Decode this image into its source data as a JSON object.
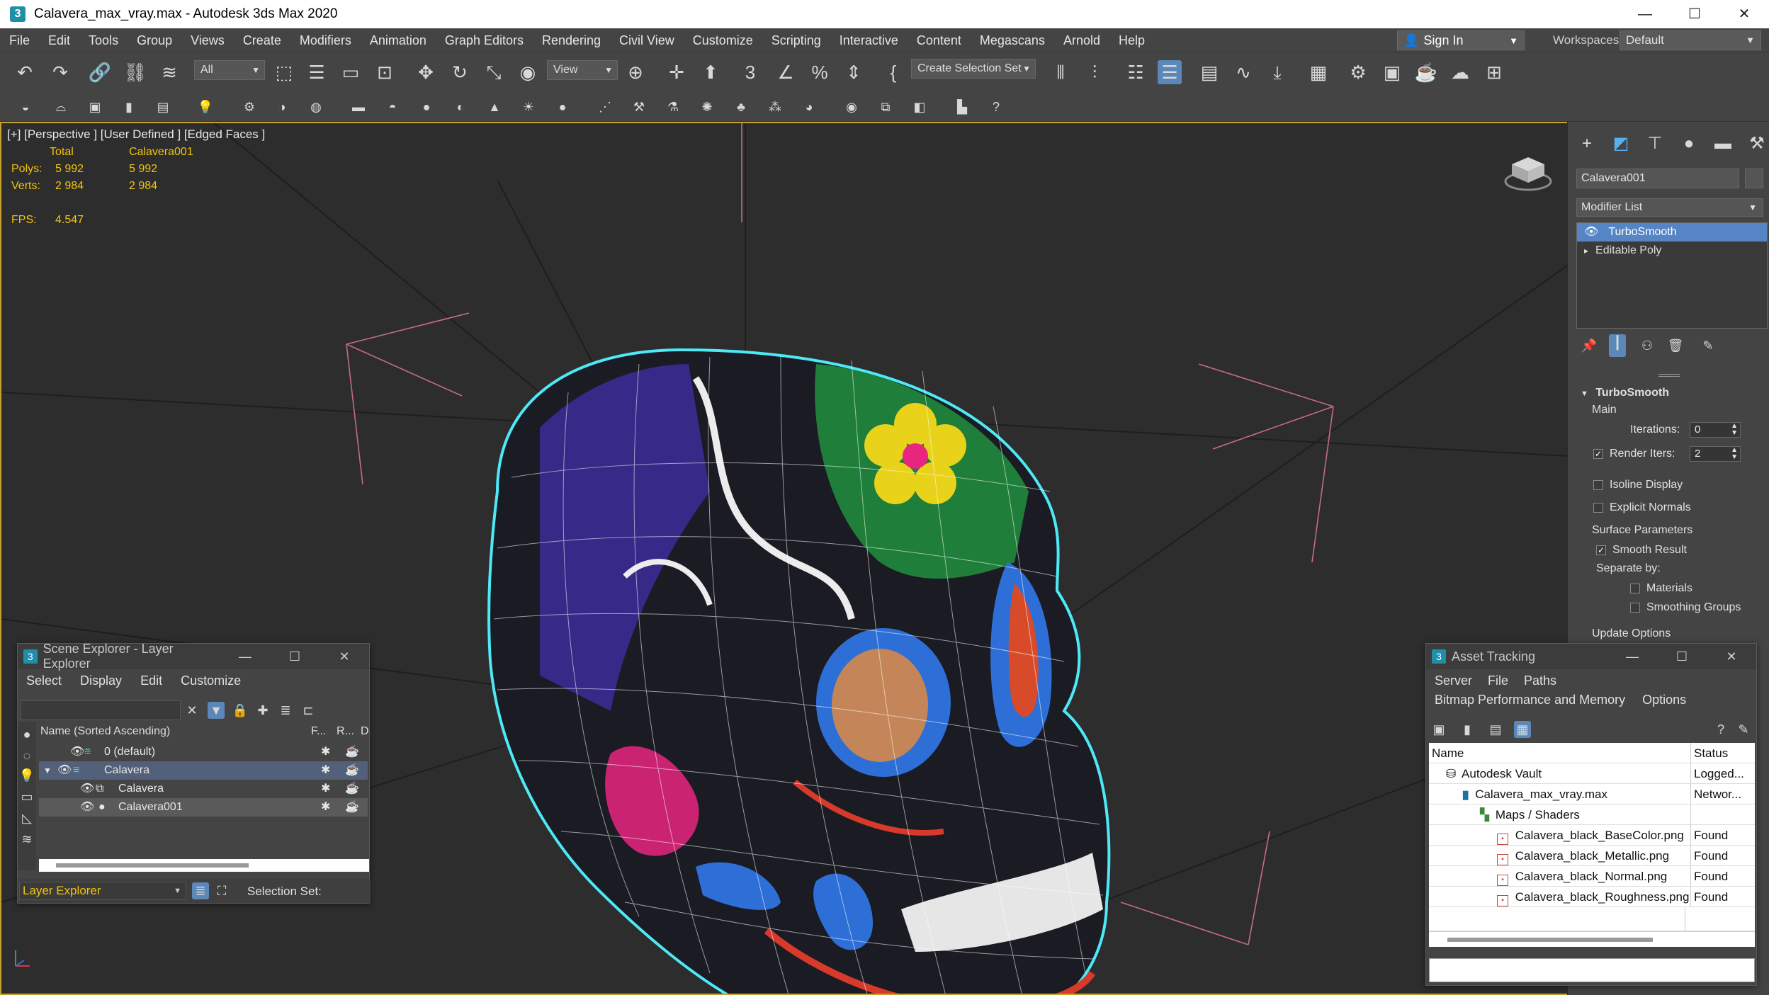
{
  "window": {
    "title": "Calavera_max_vray.max - Autodesk 3ds Max 2020",
    "app_icon": "3",
    "minimize": "—",
    "maximize": "☐",
    "close": "✕"
  },
  "menu": [
    "File",
    "Edit",
    "Tools",
    "Group",
    "Views",
    "Create",
    "Modifiers",
    "Animation",
    "Graph Editors",
    "Rendering",
    "Civil View",
    "Customize",
    "Scripting",
    "Interactive",
    "Content",
    "Megascans",
    "Arnold",
    "Help"
  ],
  "account": {
    "sign_in": "Sign In",
    "workspaces_label": "Workspaces:",
    "workspace_value": "Default"
  },
  "toolbar": {
    "selection_filter": "All",
    "ref_coord": "View",
    "selection_set": "Create Selection Set"
  },
  "viewport": {
    "label": "[+] [Perspective ] [User Defined ] [Edged Faces ]",
    "stats": {
      "col_total": "Total",
      "col_object": "Calavera001",
      "polys_label": "Polys:",
      "polys_total": "5 992",
      "polys_object": "5 992",
      "verts_label": "Verts:",
      "verts_total": "2 984",
      "verts_object": "2 984",
      "fps_label": "FPS:",
      "fps_value": "4.547"
    },
    "border_color": "#c6a32e",
    "stats_color": "#f1c40f"
  },
  "command_panel": {
    "object_name": "Calavera001",
    "modifier_list": "Modifier List",
    "stack": [
      "TurboSmooth",
      "Editable Poly"
    ],
    "rollout_title": "TurboSmooth",
    "main_label": "Main",
    "iterations_label": "Iterations:",
    "iterations_value": "0",
    "render_iters_label": "Render Iters:",
    "render_iters_value": "2",
    "render_iters_checked": true,
    "isoline_label": "Isoline Display",
    "explicit_normals_label": "Explicit Normals",
    "surface_params_label": "Surface Parameters",
    "smooth_result_label": "Smooth Result",
    "separate_by_label": "Separate by:",
    "materials_label": "Materials",
    "smoothing_groups_label": "Smoothing Groups",
    "update_options_label": "Update Options"
  },
  "scene_explorer": {
    "title": "Scene Explorer - Layer Explorer",
    "menu": [
      "Select",
      "Display",
      "Edit",
      "Customize"
    ],
    "header_name": "Name (Sorted Ascending)",
    "header_f": "F...",
    "header_r": "R...",
    "header_d": "D",
    "rows": [
      {
        "label": "0 (default)"
      },
      {
        "label": "Calavera"
      },
      {
        "label": "Calavera"
      },
      {
        "label": "Calavera001"
      }
    ],
    "footer_dropdown": "Layer Explorer",
    "selection_set_label": "Selection Set:"
  },
  "asset_tracking": {
    "title": "Asset Tracking",
    "menu1": [
      "Server",
      "File",
      "Paths"
    ],
    "menu2": [
      "Bitmap Performance and Memory",
      "Options"
    ],
    "col_name": "Name",
    "col_status": "Status",
    "rows": [
      {
        "name": "Autodesk Vault",
        "status": "Logged...",
        "indent": 0
      },
      {
        "name": "Calavera_max_vray.max",
        "status": "Networ...",
        "indent": 1
      },
      {
        "name": "Maps / Shaders",
        "status": "",
        "indent": 2
      },
      {
        "name": "Calavera_black_BaseColor.png",
        "status": "Found",
        "indent": 3
      },
      {
        "name": "Calavera_black_Metallic.png",
        "status": "Found",
        "indent": 3
      },
      {
        "name": "Calavera_black_Normal.png",
        "status": "Found",
        "indent": 3
      },
      {
        "name": "Calavera_black_Roughness.png",
        "status": "Found",
        "indent": 3
      }
    ]
  }
}
